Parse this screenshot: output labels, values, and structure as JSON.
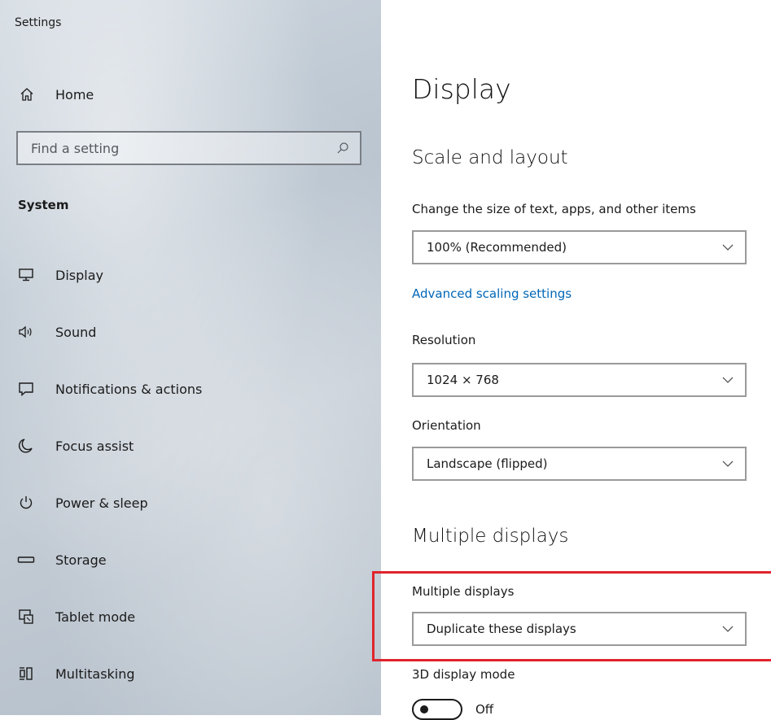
{
  "window": {
    "title": "Settings"
  },
  "sidebar": {
    "home_label": "Home",
    "search": {
      "placeholder": "Find a setting",
      "value": ""
    },
    "section_label": "System",
    "items": [
      {
        "label": "Display",
        "icon": "monitor-icon"
      },
      {
        "label": "Sound",
        "icon": "speaker-icon"
      },
      {
        "label": "Notifications & actions",
        "icon": "notification-icon"
      },
      {
        "label": "Focus assist",
        "icon": "moon-icon"
      },
      {
        "label": "Power & sleep",
        "icon": "power-icon"
      },
      {
        "label": "Storage",
        "icon": "storage-icon"
      },
      {
        "label": "Tablet mode",
        "icon": "tablet-mode-icon"
      },
      {
        "label": "Multitasking",
        "icon": "multitasking-icon"
      }
    ]
  },
  "main": {
    "title": "Display",
    "scale_layout": {
      "heading": "Scale and layout",
      "size_label": "Change the size of text, apps, and other items",
      "size_value": "100% (Recommended)",
      "advanced_link": "Advanced scaling settings",
      "resolution_label": "Resolution",
      "resolution_value": "1024 × 768",
      "orientation_label": "Orientation",
      "orientation_value": "Landscape (flipped)"
    },
    "multiple_displays": {
      "heading": "Multiple displays",
      "label": "Multiple displays",
      "value": "Duplicate these displays",
      "mode_3d_label": "3D display mode",
      "toggle_state": "Off"
    }
  },
  "colors": {
    "accent_link": "#0067b8",
    "highlight": "#e0242d"
  }
}
